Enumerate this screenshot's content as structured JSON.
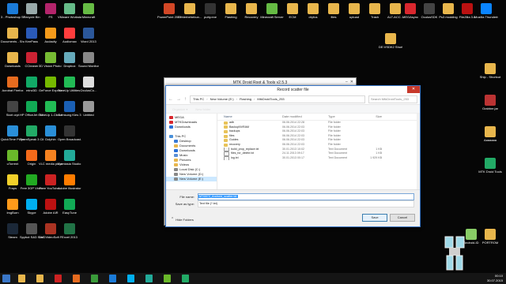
{
  "desktop_icons": [
    {
      "label": "3 - Photoshop Shortcut",
      "color": "#1b7bd8"
    },
    {
      "label": "Documents - Shortcut",
      "color": "#e8b64c"
    },
    {
      "label": "Downloads",
      "color": "#e8b64c"
    },
    {
      "label": "Acrobat Firefox",
      "color": "#e66b1f"
    },
    {
      "label": "Start orpt",
      "color": "#444"
    },
    {
      "label": "QuickTime Player",
      "color": "#2a8fd8"
    },
    {
      "label": "uTorrent",
      "color": "#6ab82a"
    },
    {
      "label": "Fraps",
      "color": "#f2d02a"
    },
    {
      "label": "ImgBurn",
      "color": "#ff9a1a"
    },
    {
      "label": "Steam",
      "color": "#1b2838"
    },
    {
      "label": "Recycle Bin",
      "color": "#9aa"
    },
    {
      "label": "KeePass",
      "color": "#2a5ab8"
    },
    {
      "label": "CCleaner",
      "color": "#c23"
    },
    {
      "label": "mind3D",
      "color": "#1a6"
    },
    {
      "label": "HP OfficeJet 6500 E710n",
      "color": "#1a5"
    },
    {
      "label": "TeamSpeak 3 Client",
      "color": "#2a6"
    },
    {
      "label": "Origin",
      "color": "#f46a1a"
    },
    {
      "label": "Free 3GP Video",
      "color": "#2a2"
    },
    {
      "label": "Skype",
      "color": "#00aff0"
    },
    {
      "label": "Spybot S&D Start Center",
      "color": "#555"
    },
    {
      "label": "FS",
      "color": "#b3246b"
    },
    {
      "label": "Audacity",
      "color": "#f59a1a"
    },
    {
      "label": "3D Vision Photo Viewer",
      "color": "#7b3"
    },
    {
      "label": "GeForce Experience",
      "color": "#76b900"
    },
    {
      "label": "TuneUp 1-Click Ma...",
      "color": "#2b5"
    },
    {
      "label": "Dolphin",
      "color": "#2a8fd8"
    },
    {
      "label": "VLC media player",
      "color": "#f58220"
    },
    {
      "label": "Free YouTube...",
      "color": "#c22"
    },
    {
      "label": "Adobe AIR",
      "color": "#b11"
    },
    {
      "label": "DVDVideoSoft Free Studio",
      "color": "#a32"
    },
    {
      "label": "VMware Workstation",
      "color": "#6b8"
    },
    {
      "label": "Audiomax",
      "color": "#ff3d3d"
    },
    {
      "label": "Dropbox",
      "color": "#6ab"
    },
    {
      "label": "TuneUp Utilities 2014",
      "color": "#2b5"
    },
    {
      "label": "Samsung Kies 3",
      "color": "#1a5fb4"
    },
    {
      "label": "Open Broadcast...",
      "color": "#333"
    },
    {
      "label": "Camtasia Studio 8",
      "color": "#2a9"
    },
    {
      "label": "Adobe Illustrator",
      "color": "#ff7c00"
    },
    {
      "label": "EasyTune",
      "color": "#1a5"
    },
    {
      "label": "Excel 2013",
      "color": "#217346"
    },
    {
      "label": "Minecraft",
      "color": "#6b4"
    },
    {
      "label": "Word 2013",
      "color": "#2b579a"
    },
    {
      "label": "Sound Monitor",
      "color": "#888"
    },
    {
      "label": "OculusCo...",
      "color": "#ddd"
    },
    {
      "label": "Untitled",
      "color": "#999"
    }
  ],
  "right_icons": [
    {
      "label": "MEGAsync",
      "color": "#d9272e"
    },
    {
      "label": "OculusSDK",
      "color": "#444"
    },
    {
      "label": "Ps3 modding",
      "color": "#e8b64c"
    },
    {
      "label": "FileZilla 3.8",
      "color": "#b11"
    },
    {
      "label": "Mozilla Thunderbird",
      "color": "#0a84ff"
    },
    {
      "label": "DE:VSDK2 Shortcut",
      "color": "#e8b64c"
    },
    {
      "label": "Ship - Shortcut",
      "color": "#e8b64c"
    },
    {
      "label": "Grabber.jar",
      "color": "#b33"
    },
    {
      "label": "Aaaaaaa",
      "color": "#e8b64c"
    },
    {
      "label": "MTK Droid Tools",
      "color": "#2a6"
    },
    {
      "label": "PORTROM",
      "color": "#e8b64c"
    },
    {
      "label": "Android-ID",
      "color": "#8c6"
    }
  ],
  "top_icons": [
    {
      "label": "PowerPoint 2013",
      "color": "#d24726"
    },
    {
      "label": "Fehlerbehebun...",
      "color": "#e8b64c"
    },
    {
      "label": "putty.exe",
      "color": "#333"
    },
    {
      "label": "Flashing",
      "color": "#e8b64c"
    },
    {
      "label": "Recovery",
      "color": "#e8b64c"
    },
    {
      "label": "Minecraft Server",
      "color": "#6b4"
    },
    {
      "label": "ECM",
      "color": "#e8b64c"
    },
    {
      "label": "dryfus",
      "color": "#e8b64c"
    },
    {
      "label": "files",
      "color": "#e8b64c"
    },
    {
      "label": "upload",
      "color": "#e8b64c"
    },
    {
      "label": "Trash",
      "color": "#e8b64c"
    },
    {
      "label": "ALT-ACC...",
      "color": "#e8b64c"
    }
  ],
  "main_window": {
    "title": "MTK Droid Root & Tools v2.5.3"
  },
  "dialog": {
    "title": "Record scatter file",
    "close_glyph": "✕",
    "back_glyph": "←",
    "forward_glyph": "→",
    "up_glyph": "↑",
    "path": [
      "This PC",
      "New Volume (E:)",
      "Flashing",
      "MtkDroidTools_253"
    ],
    "search_placeholder": "Search MtkDroidTools_253",
    "organize_label": "Organize ▾",
    "new_folder_label": "New folder",
    "nav_items": [
      {
        "label": "MEGA",
        "color": "#d9272e",
        "indent": 0,
        "selected": false
      },
      {
        "label": "MTKDownloads",
        "color": "#d9272e",
        "indent": 0,
        "selected": false
      },
      {
        "label": "Downloads",
        "color": "#2a6fd8",
        "indent": 0,
        "selected": false
      },
      {
        "label": "This PC",
        "color": "#4a90d9",
        "indent": 0,
        "selected": false
      },
      {
        "label": "Desktop",
        "color": "#3a7bd5",
        "indent": 1,
        "selected": false
      },
      {
        "label": "Documents",
        "color": "#e8b64c",
        "indent": 1,
        "selected": false
      },
      {
        "label": "Downloads",
        "color": "#2a6fd8",
        "indent": 1,
        "selected": false
      },
      {
        "label": "Music",
        "color": "#5a8fd8",
        "indent": 1,
        "selected": false
      },
      {
        "label": "Pictures",
        "color": "#e8b64c",
        "indent": 1,
        "selected": false
      },
      {
        "label": "Videos",
        "color": "#e8b64c",
        "indent": 1,
        "selected": false
      },
      {
        "label": "Local Disk (C:)",
        "color": "#888",
        "indent": 1,
        "selected": false
      },
      {
        "label": "New Volume (D:)",
        "color": "#888",
        "indent": 1,
        "selected": false
      },
      {
        "label": "New Volume (E:)",
        "color": "#888",
        "indent": 1,
        "selected": true
      }
    ],
    "columns": [
      "Name",
      "Date modified",
      "Type",
      "Size"
    ],
    "files": [
      {
        "name": "adb",
        "date": "06.06.2014 22:28",
        "type": "File folder",
        "size": ""
      },
      {
        "name": "BackupNVRAM",
        "date": "06.06.2014 22:03",
        "type": "File folder",
        "size": ""
      },
      {
        "name": "backups",
        "date": "06.06.2014 22:03",
        "type": "File folder",
        "size": ""
      },
      {
        "name": "files",
        "date": "06.06.2014 22:03",
        "type": "File folder",
        "size": ""
      },
      {
        "name": "Guides",
        "date": "06.06.2014 22:03",
        "type": "File folder",
        "size": ""
      },
      {
        "name": "recovery",
        "date": "06.06.2014 22:03",
        "type": "File folder",
        "size": ""
      },
      {
        "name": "build_prop_replace.txt",
        "date": "30.01.2013 10:02",
        "type": "Text Document",
        "size": "1 KB"
      },
      {
        "name": "files_for_delete.txt",
        "date": "24.11.2013 09:17",
        "type": "Text Document",
        "size": "1 KB"
      },
      {
        "name": "log.txt",
        "date": "30.01.2013 00:17",
        "type": "Text Document",
        "size": "1 929 KB"
      }
    ],
    "file_name_label": "File name:",
    "file_name_value": "MT6572_Android_scatter.txt",
    "save_type_label": "Save as type:",
    "save_type_value": "Text file (*.txt)",
    "save_label": "Save",
    "cancel_label": "Cancel",
    "hide_folders_label": "Hide Folders"
  },
  "taskbar": {
    "apps": [
      {
        "name": "file-explorer",
        "color": "#e8b64c"
      },
      {
        "name": "explorer",
        "color": "#e8b64c"
      },
      {
        "name": "downloads",
        "color": "#c22"
      },
      {
        "name": "firefox",
        "color": "#e66b1f"
      },
      {
        "name": "chrome",
        "color": "#3a9b3a"
      },
      {
        "name": "photoshop",
        "color": "#1b7bd8"
      },
      {
        "name": "skype",
        "color": "#00aff0"
      },
      {
        "name": "camtasia",
        "color": "#2a9"
      },
      {
        "name": "app",
        "color": "#6ab82a"
      },
      {
        "name": "mtk",
        "color": "#2a6"
      }
    ],
    "time": "00:10",
    "date": "30.07.2015"
  }
}
